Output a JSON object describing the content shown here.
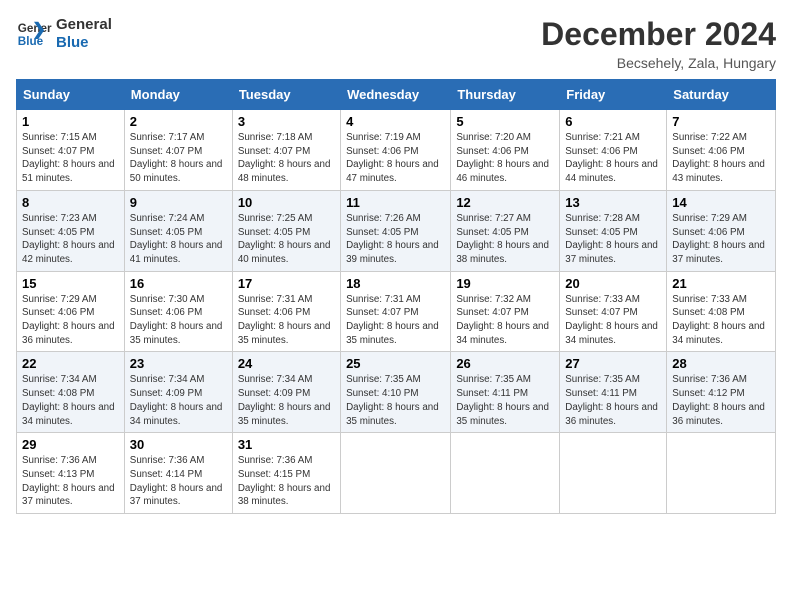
{
  "header": {
    "logo_line1": "General",
    "logo_line2": "Blue",
    "month_title": "December 2024",
    "location": "Becsehely, Zala, Hungary"
  },
  "columns": [
    "Sunday",
    "Monday",
    "Tuesday",
    "Wednesday",
    "Thursday",
    "Friday",
    "Saturday"
  ],
  "weeks": [
    [
      {
        "day": "1",
        "sunrise": "7:15 AM",
        "sunset": "4:07 PM",
        "daylight": "8 hours and 51 minutes."
      },
      {
        "day": "2",
        "sunrise": "7:17 AM",
        "sunset": "4:07 PM",
        "daylight": "8 hours and 50 minutes."
      },
      {
        "day": "3",
        "sunrise": "7:18 AM",
        "sunset": "4:07 PM",
        "daylight": "8 hours and 48 minutes."
      },
      {
        "day": "4",
        "sunrise": "7:19 AM",
        "sunset": "4:06 PM",
        "daylight": "8 hours and 47 minutes."
      },
      {
        "day": "5",
        "sunrise": "7:20 AM",
        "sunset": "4:06 PM",
        "daylight": "8 hours and 46 minutes."
      },
      {
        "day": "6",
        "sunrise": "7:21 AM",
        "sunset": "4:06 PM",
        "daylight": "8 hours and 44 minutes."
      },
      {
        "day": "7",
        "sunrise": "7:22 AM",
        "sunset": "4:06 PM",
        "daylight": "8 hours and 43 minutes."
      }
    ],
    [
      {
        "day": "8",
        "sunrise": "7:23 AM",
        "sunset": "4:05 PM",
        "daylight": "8 hours and 42 minutes."
      },
      {
        "day": "9",
        "sunrise": "7:24 AM",
        "sunset": "4:05 PM",
        "daylight": "8 hours and 41 minutes."
      },
      {
        "day": "10",
        "sunrise": "7:25 AM",
        "sunset": "4:05 PM",
        "daylight": "8 hours and 40 minutes."
      },
      {
        "day": "11",
        "sunrise": "7:26 AM",
        "sunset": "4:05 PM",
        "daylight": "8 hours and 39 minutes."
      },
      {
        "day": "12",
        "sunrise": "7:27 AM",
        "sunset": "4:05 PM",
        "daylight": "8 hours and 38 minutes."
      },
      {
        "day": "13",
        "sunrise": "7:28 AM",
        "sunset": "4:05 PM",
        "daylight": "8 hours and 37 minutes."
      },
      {
        "day": "14",
        "sunrise": "7:29 AM",
        "sunset": "4:06 PM",
        "daylight": "8 hours and 37 minutes."
      }
    ],
    [
      {
        "day": "15",
        "sunrise": "7:29 AM",
        "sunset": "4:06 PM",
        "daylight": "8 hours and 36 minutes."
      },
      {
        "day": "16",
        "sunrise": "7:30 AM",
        "sunset": "4:06 PM",
        "daylight": "8 hours and 35 minutes."
      },
      {
        "day": "17",
        "sunrise": "7:31 AM",
        "sunset": "4:06 PM",
        "daylight": "8 hours and 35 minutes."
      },
      {
        "day": "18",
        "sunrise": "7:31 AM",
        "sunset": "4:07 PM",
        "daylight": "8 hours and 35 minutes."
      },
      {
        "day": "19",
        "sunrise": "7:32 AM",
        "sunset": "4:07 PM",
        "daylight": "8 hours and 34 minutes."
      },
      {
        "day": "20",
        "sunrise": "7:33 AM",
        "sunset": "4:07 PM",
        "daylight": "8 hours and 34 minutes."
      },
      {
        "day": "21",
        "sunrise": "7:33 AM",
        "sunset": "4:08 PM",
        "daylight": "8 hours and 34 minutes."
      }
    ],
    [
      {
        "day": "22",
        "sunrise": "7:34 AM",
        "sunset": "4:08 PM",
        "daylight": "8 hours and 34 minutes."
      },
      {
        "day": "23",
        "sunrise": "7:34 AM",
        "sunset": "4:09 PM",
        "daylight": "8 hours and 34 minutes."
      },
      {
        "day": "24",
        "sunrise": "7:34 AM",
        "sunset": "4:09 PM",
        "daylight": "8 hours and 35 minutes."
      },
      {
        "day": "25",
        "sunrise": "7:35 AM",
        "sunset": "4:10 PM",
        "daylight": "8 hours and 35 minutes."
      },
      {
        "day": "26",
        "sunrise": "7:35 AM",
        "sunset": "4:11 PM",
        "daylight": "8 hours and 35 minutes."
      },
      {
        "day": "27",
        "sunrise": "7:35 AM",
        "sunset": "4:11 PM",
        "daylight": "8 hours and 36 minutes."
      },
      {
        "day": "28",
        "sunrise": "7:36 AM",
        "sunset": "4:12 PM",
        "daylight": "8 hours and 36 minutes."
      }
    ],
    [
      {
        "day": "29",
        "sunrise": "7:36 AM",
        "sunset": "4:13 PM",
        "daylight": "8 hours and 37 minutes."
      },
      {
        "day": "30",
        "sunrise": "7:36 AM",
        "sunset": "4:14 PM",
        "daylight": "8 hours and 37 minutes."
      },
      {
        "day": "31",
        "sunrise": "7:36 AM",
        "sunset": "4:15 PM",
        "daylight": "8 hours and 38 minutes."
      },
      null,
      null,
      null,
      null
    ]
  ]
}
